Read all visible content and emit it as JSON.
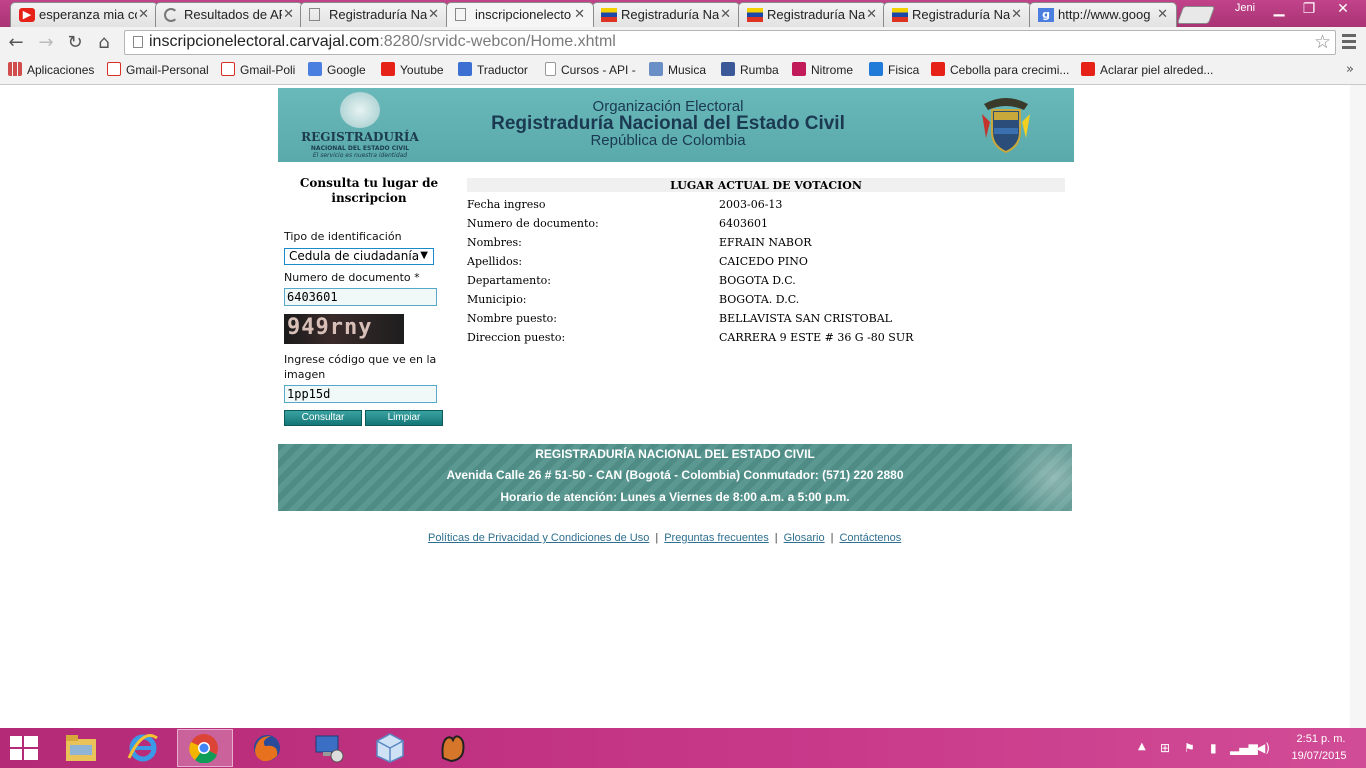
{
  "browser": {
    "tabs": [
      {
        "title": "esperanza mia co",
        "icon": "youtube-icon"
      },
      {
        "title": "Resultados de AF",
        "icon": "loading-icon"
      },
      {
        "title": "Registraduría Na",
        "icon": "page-icon"
      },
      {
        "title": "inscripcionelecto",
        "icon": "page-icon",
        "active": true
      },
      {
        "title": "Registraduría Na",
        "icon": "registraduria-icon"
      },
      {
        "title": "Registraduría Na",
        "icon": "registraduria-icon"
      },
      {
        "title": "Registraduría Na",
        "icon": "registraduria-icon"
      },
      {
        "title": "http://www.goog",
        "icon": "google-icon"
      }
    ],
    "close_glyph": "✕",
    "user_name": "Jeni",
    "url_host": "inscripcionelectoral.carvajal.com",
    "url_rest": ":8280/srvidc-webcon/Home.xhtml",
    "bookmarks": [
      {
        "label": "Aplicaciones",
        "icon": "apps-icon",
        "color": "#d14d4d"
      },
      {
        "label": "Gmail-Personal",
        "icon": "gmail-icon",
        "color": "#d93025"
      },
      {
        "label": "Gmail-Poli",
        "icon": "gmail-icon",
        "color": "#d93025"
      },
      {
        "label": "Google",
        "icon": "google-icon",
        "color": "#4285f4"
      },
      {
        "label": "Youtube",
        "icon": "youtube-icon",
        "color": "#e62117"
      },
      {
        "label": "Traductor",
        "icon": "translate-icon",
        "color": "#3c6fd1"
      },
      {
        "label": "Cursos - API -",
        "icon": "page-icon",
        "color": "#cccccc"
      },
      {
        "label": "Musica",
        "icon": "music-icon",
        "color": "#6a8fc7"
      },
      {
        "label": "Rumba",
        "icon": "facebook-icon",
        "color": "#3b5998"
      },
      {
        "label": "Nitrome",
        "icon": "nitrome-icon",
        "color": "#c21b5a"
      },
      {
        "label": "Fisica",
        "icon": "dropbox-icon",
        "color": "#1f7ad8"
      },
      {
        "label": "Cebolla para crecimi...",
        "icon": "youtube-icon",
        "color": "#e62117"
      },
      {
        "label": "Aclarar piel alreded...",
        "icon": "youtube-icon",
        "color": "#e62117"
      }
    ],
    "more_glyph": "»"
  },
  "banner": {
    "logo_text": "REGISTRADURÍA",
    "logo_sub1": "NACIONAL DEL ESTADO CIVIL",
    "logo_sub2": "El servicio es nuestra identidad",
    "line1": "Organización Electoral",
    "line2": "Registraduría Nacional del Estado Civil",
    "line3": "República de Colombia"
  },
  "form": {
    "title": "Consulta tu lugar de inscripcion",
    "id_type_label": "Tipo de identificación",
    "id_type_value": "Cedula de ciudadanía",
    "doc_label": "Numero de documento *",
    "doc_value": "6403601",
    "captcha_text": "949rny",
    "captcha_label": "Ingrese código que ve en la imagen",
    "captcha_value": "1pp15d",
    "consult_button": "Consultar",
    "clear_button": "Limpiar"
  },
  "result": {
    "title": "LUGAR ACTUAL DE VOTACION",
    "rows": [
      {
        "label": "Fecha ingreso",
        "value": "2003-06-13"
      },
      {
        "label": "Numero de documento:",
        "value": "6403601"
      },
      {
        "label": "Nombres:",
        "value": "EFRAIN NABOR"
      },
      {
        "label": "Apellidos:",
        "value": "CAICEDO PINO"
      },
      {
        "label": "Departamento:",
        "value": "BOGOTA D.C."
      },
      {
        "label": "Municipio:",
        "value": "BOGOTA. D.C."
      },
      {
        "label": "Nombre puesto:",
        "value": "BELLAVISTA SAN CRISTOBAL"
      },
      {
        "label": "Direccion puesto:",
        "value": "CARRERA 9 ESTE # 36 G -80 SUR"
      }
    ]
  },
  "footer": {
    "line1": "REGISTRADURÍA NACIONAL DEL ESTADO CIVIL",
    "line2": "Avenida Calle 26 # 51-50 - CAN (Bogotá - Colombia) Conmutador: (571) 220 2880",
    "line3": "Horario de atención: Lunes a Viernes de 8:00 a.m. a 5:00 p.m."
  },
  "links": {
    "privacy": "Políticas de Privacidad y Condiciones de Uso",
    "faq": "Preguntas frecuentes",
    "glossary": "Glosario",
    "contact": "Contáctenos",
    "separator": "|"
  },
  "taskbar": {
    "time": "2:51 p. m.",
    "date": "19/07/2015"
  }
}
